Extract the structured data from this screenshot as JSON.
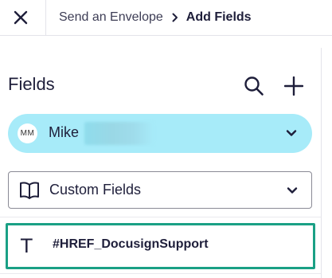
{
  "header": {
    "close_icon": "close-icon",
    "breadcrumb": {
      "parent": "Send an Envelope",
      "separator_icon": "chevron-right-icon",
      "current": "Add Fields"
    }
  },
  "panel": {
    "title": "Fields",
    "search_icon": "search-icon",
    "add_icon": "plus-icon",
    "recipient": {
      "initials": "MM",
      "name": "Mike",
      "name_redacted": true,
      "color": "#a7ebf9",
      "chevron_icon": "chevron-down-icon"
    },
    "category_select": {
      "icon": "book-icon",
      "selected": "Custom Fields",
      "chevron_icon": "chevron-down-icon"
    },
    "fields": [
      {
        "type_icon": "text-field-icon",
        "glyph": "T",
        "label": "#HREF_DocusignSupport",
        "selected": true
      }
    ],
    "selection_color": "#1aa085"
  }
}
